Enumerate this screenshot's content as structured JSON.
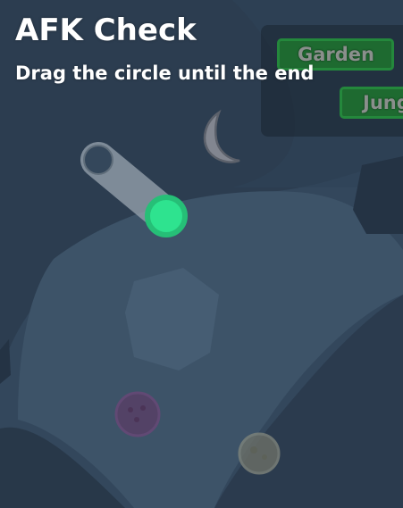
{
  "afk": {
    "title": "AFK Check",
    "instruction": "Drag the circle until the end"
  },
  "zones": [
    {
      "label": "Garden"
    },
    {
      "label": "Jungle"
    }
  ],
  "colors": {
    "background": "#33475c",
    "handle": "#2ee38f",
    "track": "#8e9aa6",
    "zone_button": "#1e6a30"
  },
  "icons": {
    "moon": "crescent-moon-icon",
    "ghost_orb_purple": "purple-orb-icon",
    "ghost_orb_grey": "grey-orb-icon"
  }
}
